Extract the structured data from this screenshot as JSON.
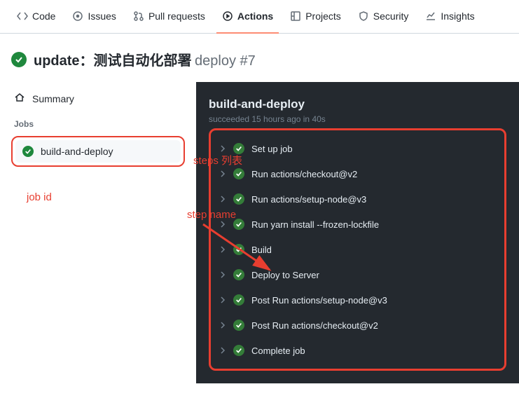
{
  "tabs": [
    {
      "label": "Code"
    },
    {
      "label": "Issues"
    },
    {
      "label": "Pull requests"
    },
    {
      "label": "Actions"
    },
    {
      "label": "Projects"
    },
    {
      "label": "Security"
    },
    {
      "label": "Insights"
    }
  ],
  "active_tab_index": 3,
  "run": {
    "title": "update：测试自动化部署",
    "branch": "deploy #7"
  },
  "sidebar": {
    "summary": "Summary",
    "jobs_label": "Jobs",
    "job_name": "build-and-deploy"
  },
  "panel": {
    "title": "build-and-deploy",
    "subtitle": "succeeded 15 hours ago in 40s",
    "steps": [
      "Set up job",
      "Run actions/checkout@v2",
      "Run actions/setup-node@v3",
      "Run yarn install --frozen-lockfile",
      "Build",
      "Deploy to Server",
      "Post Run actions/setup-node@v3",
      "Post Run actions/checkout@v2",
      "Complete job"
    ]
  },
  "annotations": {
    "steps_list": "steps 列表",
    "job_id": "job id",
    "step_name": "step name"
  }
}
